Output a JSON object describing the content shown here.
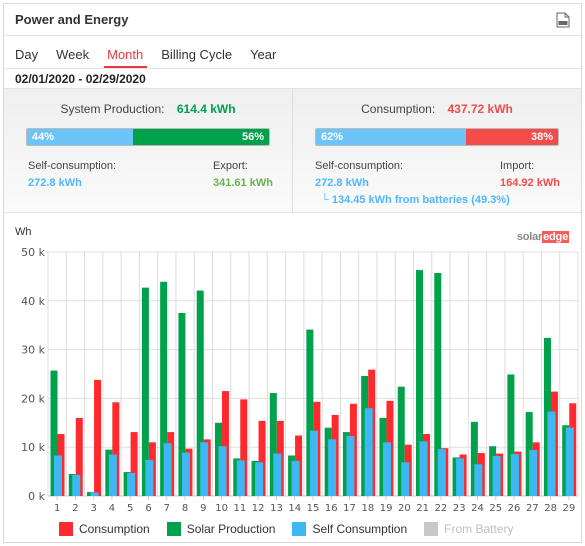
{
  "header": {
    "title": "Power and Energy",
    "csv_icon": "csv-file-icon"
  },
  "tabs": [
    {
      "label": "Day",
      "active": false
    },
    {
      "label": "Week",
      "active": false
    },
    {
      "label": "Month",
      "active": true
    },
    {
      "label": "Billing Cycle",
      "active": false
    },
    {
      "label": "Year",
      "active": false
    }
  ],
  "date_range": "02/01/2020 - 02/29/2020",
  "production": {
    "label": "System Production:",
    "value": "614.4 kWh",
    "self_pct": 44,
    "export_pct": 56,
    "self_pct_label": "44%",
    "export_pct_label": "56%",
    "self_label": "Self-consumption:",
    "self_value": "272.8 kWh",
    "export_label": "Export:",
    "export_value": "341.61 kWh"
  },
  "consumption": {
    "label": "Consumption:",
    "value": "437.72 kWh",
    "self_pct": 62,
    "import_pct": 38,
    "self_pct_label": "62%",
    "import_pct_label": "38%",
    "self_label": "Self-consumption:",
    "self_value": "272.8 kWh",
    "import_label": "Import:",
    "import_value": "164.92 kWh",
    "battery_note": "└ 134.45 kWh from batteries (49.3%)"
  },
  "colors": {
    "consumption": "#ff2a2f",
    "production": "#00a14b",
    "self": "#3db8f5",
    "battery": "#c8c8c8",
    "production_text": "#00a14b",
    "export_text": "#69b34c",
    "consumption_text": "#f44b4b",
    "self_text": "#4db8ff"
  },
  "logo": {
    "part1": "solar",
    "part2": "edge"
  },
  "chart_data": {
    "type": "bar",
    "ylabel": "Wh",
    "ylim": [
      0,
      50000
    ],
    "yticks": [
      0,
      10000,
      20000,
      30000,
      40000,
      50000
    ],
    "ytick_labels": [
      "0 k",
      "10 k",
      "20 k",
      "30 k",
      "40 k",
      "50 k"
    ],
    "grid": true,
    "legend_position": "bottom",
    "categories": [
      "1",
      "2",
      "3",
      "4",
      "5",
      "6",
      "7",
      "8",
      "9",
      "10",
      "11",
      "12",
      "13",
      "14",
      "15",
      "16",
      "17",
      "18",
      "19",
      "20",
      "21",
      "22",
      "23",
      "24",
      "25",
      "26",
      "27",
      "28",
      "29"
    ],
    "series": [
      {
        "name": "Consumption",
        "values": [
          12700,
          16000,
          23800,
          19200,
          13100,
          11000,
          13100,
          9700,
          11600,
          21500,
          19800,
          15400,
          15400,
          12400,
          19300,
          16600,
          18900,
          25900,
          19500,
          10500,
          12700,
          9800,
          8500,
          8800,
          8700,
          9100,
          11000,
          21400,
          19000
        ]
      },
      {
        "name": "Solar Production",
        "values": [
          25700,
          4500,
          800,
          9500,
          4900,
          42700,
          43900,
          37500,
          42100,
          15000,
          7700,
          7200,
          21100,
          8300,
          34100,
          14000,
          13100,
          24600,
          16000,
          22400,
          46300,
          45700,
          7900,
          15200,
          10200,
          24900,
          17200,
          32400,
          14500
        ]
      },
      {
        "name": "Self Consumption",
        "values": [
          8300,
          4300,
          700,
          8500,
          4700,
          7400,
          10800,
          8900,
          11000,
          10200,
          7300,
          6900,
          8700,
          7200,
          13400,
          11600,
          12300,
          18000,
          11000,
          6900,
          11200,
          9600,
          7700,
          6500,
          8200,
          8600,
          9400,
          17300,
          14000
        ]
      },
      {
        "name": "From Battery",
        "values": [],
        "hidden": true
      }
    ]
  }
}
